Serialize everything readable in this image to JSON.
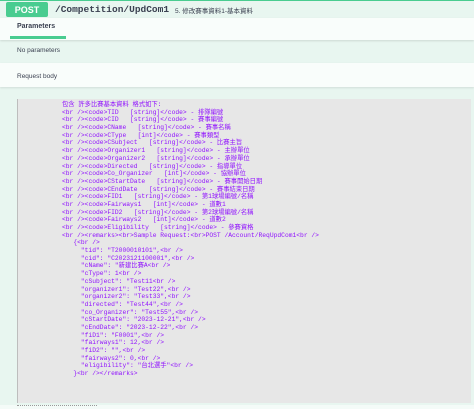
{
  "operation": {
    "method": "POST",
    "path": "/Competition/UpdCom1",
    "summary": "5. 修改賽事資料1-基本資料"
  },
  "tabs": {
    "parameters": "Parameters"
  },
  "parameters": {
    "empty_text": "No parameters"
  },
  "request_body": {
    "label": "Request body"
  },
  "description_lines": [
    "包含 許多比賽基本資料 格式如下:",
    "<br /><code>TID   [string]</code> - 排隊編號",
    "<br /><code>CID   [string]</code> - 賽事編號",
    "<br /><code>CName   [string]</code> - 賽事名稱",
    "<br /><code>CType   [int]</code> - 賽事類型",
    "<br /><code>CSubject   [string]</code> - 比賽主旨",
    "<br /><code>Organizer1   [string]</code> - 主辦單位",
    "<br /><code>Organizer2   [string]</code> - 承辦單位",
    "<br /><code>Directed   [string]</code> - 指導單位",
    "<br /><code>Co_Organizer   [int]</code> - 協辦單位",
    "<br /><code>CStartDate   [string]</code> - 賽事開始日期",
    "<br /><code>CEndDate   [string]</code> - 賽事結束日期",
    "<br /><code>FID1   [string]</code> - 第1球場編號/名稱",
    "<br /><code>Fairways1   [int]</code> - 道數1",
    "<br /><code>FID2   [string]</code> - 第2球場編號/名稱",
    "<br /><code>Fairways2   [int]</code> - 道數2",
    "<br /><code>Eligibility   [string]</code> - 參賽資格",
    "<br /><remarks><br>Sample Request:<br>POST /Account/ReqUpdCom1<br />",
    "   {<br />",
    "     \"tid\": \"T2000010101\",<br />",
    "     \"cid\": \"C2023121100001\",<br />",
    "     \"cName\": \"新建比賽A<br />",
    "     \"cType\": 1<br />",
    "     \"cSubject\": \"Test11<br />",
    "     \"organizer1\": \"Test22\",<br />",
    "     \"organizer2\": \"Test33\",<br />",
    "     \"directed\": \"Test44\",<br />",
    "     \"co_Organizer\": \"Test55\",<br />",
    "     \"cStartDate\": \"2023-12-21\",<br />",
    "     \"cEndDate\": \"2023-12-22\",<br />",
    "     \"fiD1\": \"F0001\",<br />",
    "     \"fairways1\": 12,<br />",
    "     \"fiD2\": \"\",<br />",
    "     \"fairways2\": 0,<br />",
    "     \"eligibility\": \"台北選手\"<br />",
    "   }<br /></remarks>"
  ],
  "colors": {
    "method_bg": "#49cc90",
    "block_bg": "#e8f6f0",
    "code_text": "#9012fe",
    "markdown_bg": "#e7e7e7"
  }
}
